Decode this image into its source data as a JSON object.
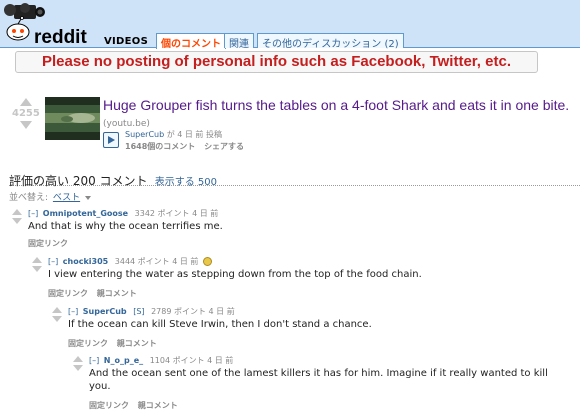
{
  "header": {
    "subreddit": "VIDEOS",
    "tabs": [
      "個のコメント",
      "関連",
      "その他のディスカッション (2)"
    ]
  },
  "notice": "Please no posting of personal info such as Facebook, Twitter, etc.",
  "post": {
    "score": "4255",
    "title": "Huge Grouper fish turns the tables on a 4-foot Shark and eats it in one bite.",
    "domain": "(youtu.be)",
    "author": "SuperCub",
    "tagline_suffix": "が 4 日 前 投稿",
    "comments": "1648個のコメント",
    "share": "シェアする"
  },
  "comments_header": {
    "title": "評価の高い 200 コメント",
    "show_more": "表示する 500",
    "sort_label": "並べ替え:",
    "sort_value": "ベスト"
  },
  "comments": [
    {
      "expand": "[–]",
      "author": "Omnipotent_Goose",
      "points": "3342 ポイント 4 日 前",
      "body": "And that is why the ocean terrifies me.",
      "buttons": [
        "固定リンク"
      ]
    },
    {
      "expand": "[–]",
      "author": "chocki305",
      "points": "3444 ポイント 4 日 前",
      "body": "I view entering the water as stepping down from the top of the food chain.",
      "buttons": [
        "固定リンク",
        "親コメント"
      ]
    },
    {
      "expand": "[–]",
      "author": "SuperCub",
      "op": "[S]",
      "points": "2789 ポイント 4 日 前",
      "body": "If the ocean can kill Steve Irwin, then I don't stand a chance.",
      "buttons": [
        "固定リンク",
        "親コメント"
      ]
    },
    {
      "expand": "[–]",
      "author": "N_o_p_e_",
      "points": "1104 ポイント 4 日 前",
      "body_line1": "And the ocean sent one of the lamest killers it has for him. Imagine if it really wanted to kill",
      "body_line2": "you.",
      "buttons": [
        "固定リンク",
        "親コメント"
      ]
    }
  ],
  "colors": {
    "header_bg": "#cee3f8",
    "link": "#369",
    "visited_title": "#551a8b",
    "notice_text": "#c41e1e",
    "selected_tab": "#ff4500"
  }
}
